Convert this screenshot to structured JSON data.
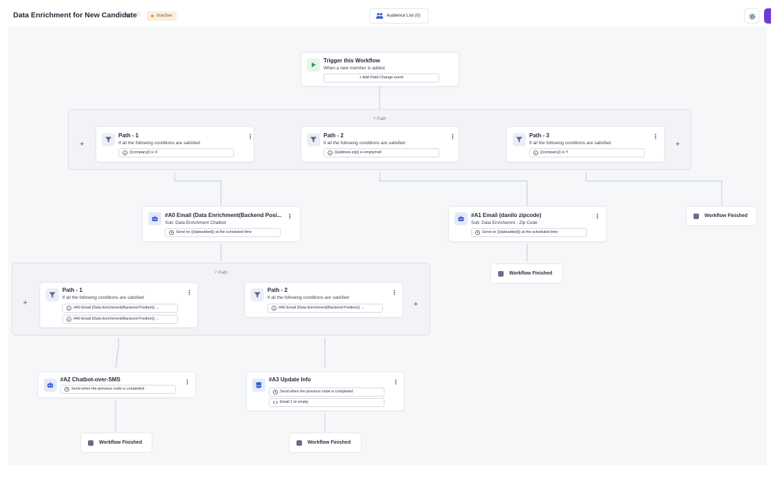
{
  "header": {
    "workflow_title": "Data Enrichment for New Candidate",
    "status": "Inactive",
    "audience_button": "Audience List (0)"
  },
  "colors": {
    "accent_purple": "#6c3bd8",
    "status_inactive_bg": "#fbeede",
    "status_inactive_dot": "#e39a3c",
    "canvas_bg": "#f6f7f9"
  },
  "icons": {
    "trigger": "play-icon",
    "path": "filter-icon",
    "email": "robot-icon",
    "update": "database-icon",
    "finished": "stop-square-icon",
    "time": "clock-icon",
    "info": "info-icon",
    "code": "code-icon"
  },
  "trigger": {
    "title": "Trigger this Workflow",
    "subtitle": "When a new member is added",
    "add_event": "Add Field Change event"
  },
  "group1": {
    "label": "Path",
    "paths": [
      {
        "title": "Path - 1",
        "subtitle": "If all the following conditions are satisfied",
        "conditions": [
          "{{company}} is X"
        ]
      },
      {
        "title": "Path - 2",
        "subtitle": "If all the following conditions are satisfied",
        "conditions": [
          "{{address.zip}} is empty/null"
        ]
      },
      {
        "title": "Path - 3",
        "subtitle": "If all the following conditions are satisfied",
        "conditions": [
          "{{company}} is Y"
        ]
      }
    ]
  },
  "email_a0": {
    "title": "#A0 Email (Data Enrichment(Backend Posi...",
    "subtitle": "Sub: Data Enrichment Chatbot",
    "schedule": "Send on {{dateadded}} at the scheduled time"
  },
  "email_a1": {
    "title": "#A1 Email (danilo zipcode)",
    "subtitle": "Sub: Data Enrichemnt - Zip Code",
    "schedule": "Send on {{dateadded}} at the scheduled time"
  },
  "group2": {
    "label": "Path",
    "paths": [
      {
        "title": "Path - 1",
        "subtitle": "If all the following conditions are satisfied",
        "conditions": [
          "#A0 Email (Data Enrichment(Backend Position)) ...",
          "#A0 Email (Data Enrichment(Backend Position)) ..."
        ]
      },
      {
        "title": "Path - 2",
        "subtitle": "If all the following conditions are satisfied",
        "conditions": [
          "#A0 Email (Data Enrichment(Backend Position)) ..."
        ]
      }
    ]
  },
  "chatbot_a2": {
    "title": "#A2 Chatbot-over-SMS",
    "schedule": "Send when the previous node is completed"
  },
  "update_a3": {
    "title": "#A3 Update Info",
    "schedule": "Send when the previous node is completed",
    "action": "Email 1 to empty"
  },
  "finished_label": "Workflow Finished"
}
